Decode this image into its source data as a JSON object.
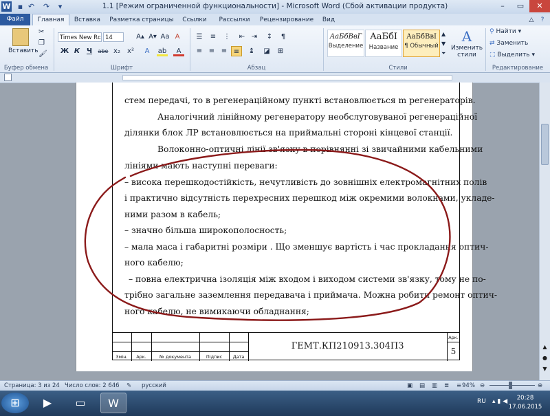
{
  "window": {
    "title": "1.1 [Режим ограниченной функциональности] - Microsoft Word (Сбой активации продукта)",
    "app_icon": "W",
    "quick_access": [
      "save-icon",
      "undo-icon",
      "redo-icon",
      "customize-icon"
    ],
    "controls": [
      "minimize-icon",
      "maximize-icon",
      "close-icon"
    ]
  },
  "tabs": {
    "file": "Файл",
    "home": "Главная",
    "insert": "Вставка",
    "page_layout": "Разметка страницы",
    "references": "Ссылки",
    "mailings": "Рассылки",
    "review": "Рецензирование",
    "view": "Вид"
  },
  "ribbon": {
    "clipboard": {
      "group": "Буфер обмена",
      "paste": "Вставить"
    },
    "font": {
      "group": "Шрифт",
      "name": "Times New Rc",
      "size": "14",
      "bold": "Ж",
      "italic": "К",
      "underline": "Ч",
      "strike": "abe",
      "sub": "x₂",
      "sup": "x²",
      "grow": "A▴",
      "shrink": "A▾",
      "aa": "Aa",
      "clear": "A",
      "highlight": "ab",
      "color": "A"
    },
    "paragraph": {
      "group": "Абзац",
      "pilcrow": "¶"
    },
    "styles": {
      "group": "Стили",
      "items": [
        {
          "sample": "АаБбВвГ",
          "name": "Выделение"
        },
        {
          "sample": "АаБбI",
          "name": "Название"
        },
        {
          "sample": "АаБбВвI",
          "name": "¶ Обычный"
        }
      ],
      "change": "Изменить стили"
    },
    "editing": {
      "group": "Редактирование",
      "find": "Найти",
      "replace": "Заменить",
      "select": "Выделить"
    }
  },
  "document": {
    "paragraphs": [
      "стем передачі, то в регенераційному пункті встановлюється m регенераторів.",
      "Аналогічний лінійному регенератору необслуговуваної регенераційної",
      "ділянки блок ЛР встановлюється на приймальні стороні кінцевої станції.",
      "Волоконно-оптичні лінії зв'язку в порівнянні зі звичайними кабельними",
      "лініями мають наступні переваги:",
      "– висока перешкодостійкість, нечутливість до зовнішніх електромагнітних полів",
      "і практично відсутність перехресних перешкод між окремими волокнами, укладе-",
      "ними разом в кабель;",
      "– значно більша широкополосность;",
      "– мала маса і габаритні розміри . Що зменшує вартість і час прокладання оптич-",
      "ного кабелю;",
      "– повна електрична ізоляція між входом і виходом системи зв'язку, тому не по-",
      "трібно загальне заземлення передавача і приймача. Можна робити ремонт оптич-",
      "ного кабелю, не вимикаючи обладнання;"
    ],
    "stamp": {
      "code": "ГЕМТ.КП210913.304ПЗ",
      "sheet_label": "Арк.",
      "sheet_number": "5",
      "cols": [
        "Змін.",
        "Арк.",
        "№ документа",
        "Підпис",
        "Дата"
      ]
    }
  },
  "statusbar": {
    "page": "Страница: 3 из 24",
    "words": "Число слов: 2 646",
    "language": "русский",
    "zoom": "94%"
  },
  "taskbar": {
    "language": "RU",
    "time": "20:28",
    "date": "17.06.2015"
  }
}
